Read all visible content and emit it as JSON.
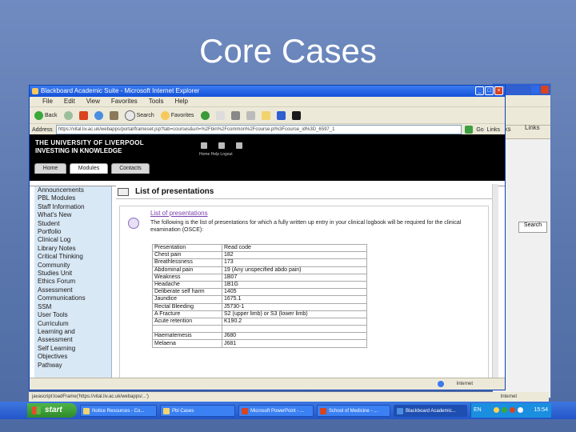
{
  "slide": {
    "title": "Core Cases"
  },
  "bg_window": {
    "links": "Links",
    "links2": "Links",
    "search_button": "Search"
  },
  "ie": {
    "title": "Blackboard Academic Suite - Microsoft Internet Explorer",
    "menu": [
      "File",
      "Edit",
      "View",
      "Favorites",
      "Tools",
      "Help"
    ],
    "toolbar": {
      "back": "Back",
      "search": "Search",
      "favorites": "Favorites"
    },
    "address_label": "Address",
    "address_value": "https://vital.liv.ac.uk/webapps/portal/frameset.jsp?tab=courses&url=%2Fbin%2Fcommon%2Fcourse.pl%3Fcourse_id%3D_6597_1",
    "go": "Go",
    "links": "Links"
  },
  "site": {
    "university": "THE UNIVERSITY OF LIVERPOOL",
    "tagline": "INVESTING IN KNOWLEDGE",
    "head_links": "Home  Help  Logout",
    "tabs": [
      {
        "label": "Home",
        "active": false
      },
      {
        "label": "Modules",
        "active": true
      },
      {
        "label": "Contacts",
        "active": false
      }
    ],
    "nav": [
      "Announcements",
      "PBL Modules",
      "Staff Information",
      "What's New",
      "Student",
      "Portfolio",
      "Clinical Log",
      "Library Notes",
      "Critical Thinking",
      "Community",
      "Studies Unit",
      "Ethics Forum",
      "Assessment",
      "Communications",
      "SSM",
      "User Tools",
      "Curriculum",
      "Learning and",
      "Assessment",
      "Self Learning",
      "Objectives",
      "Pathway"
    ]
  },
  "content": {
    "heading": "List of presentations",
    "sub_heading": "List of presentations",
    "description": "The following is the list of presentations for which a fully written up entry in your clinical logbook will be required for the clinical examination (OSCE):",
    "rows": [
      [
        "Presentation",
        "Read code"
      ],
      [
        "Chest pain",
        "182"
      ],
      [
        "Breathlessness",
        "173"
      ],
      [
        "Abdominal pain",
        "19 (Any unspecified abdo pain)"
      ],
      [
        "Weakness",
        "1B07"
      ],
      [
        "Headache",
        "1B1G"
      ],
      [
        "Deliberate self harm",
        "1405"
      ],
      [
        "Jaundice",
        "1675.1"
      ],
      [
        "Rectal Bleeding",
        "J5730-1"
      ],
      [
        "A Fracture",
        "S2 (upper limb) or S3 (lower limb)"
      ],
      [
        "Acute retention",
        "K190.2"
      ],
      [
        "",
        ""
      ],
      [
        "Haematemesis",
        "J680"
      ],
      [
        "Melaena",
        "J681"
      ]
    ]
  },
  "statusbar": {
    "internet": "Internet"
  },
  "status2": {
    "left": "javascript:loadFrame('https://vital.liv.ac.uk/webapps/...')",
    "right": "Internet"
  },
  "taskbar": {
    "start": "start",
    "items": [
      "Notice Resources - Co...",
      "Pbl Cases",
      "Microsoft PowerPoint - ...",
      "School of Medicine - ...",
      "Blackboard Academic..."
    ],
    "lang": "EN",
    "clock": "15:54"
  }
}
